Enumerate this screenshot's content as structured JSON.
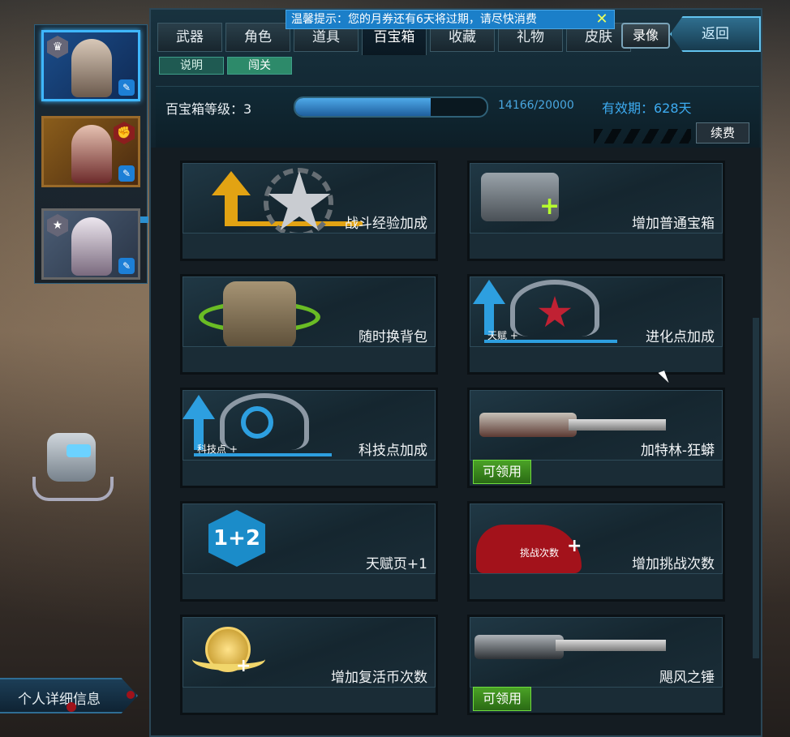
{
  "notice": {
    "text": "温馨提示：您的月券还有6天将过期，请尽快消费",
    "close_icon": "close-icon",
    "color": "#1b7fc9"
  },
  "tabs": [
    {
      "label": "武器"
    },
    {
      "label": "角色"
    },
    {
      "label": "道具"
    },
    {
      "label": "百宝箱",
      "active": true
    },
    {
      "label": "收藏"
    },
    {
      "label": "礼物"
    },
    {
      "label": "皮肤"
    }
  ],
  "record_button": "录像",
  "back_button": "返回",
  "subtabs": [
    {
      "label": "说明"
    },
    {
      "label": "闯关",
      "active": true
    }
  ],
  "treasure": {
    "level_label": "百宝箱等级：3",
    "progress_current": 14166,
    "progress_max": 20000,
    "progress_text": "14166/20000",
    "valid_text": "有效期：628天",
    "renew_button": "续费"
  },
  "items": [
    {
      "label": "战斗经验加成",
      "icon": "battle-exp-star-icon"
    },
    {
      "label": "增加普通宝箱",
      "icon": "crate-plus-icon"
    },
    {
      "label": "随时换背包",
      "icon": "backpack-icon"
    },
    {
      "label": "进化点加成",
      "icon": "evolution-wings-icon",
      "icon_text": "天赋 +"
    },
    {
      "label": "科技点加成",
      "icon": "tech-wings-icon",
      "icon_text": "科技点 +"
    },
    {
      "label": "加特林-狂蟒",
      "icon": "gatling-gun-icon",
      "claim": "可领用"
    },
    {
      "label": "天赋页+1",
      "icon": "talent-page-hex-icon",
      "icon_text": "1+2"
    },
    {
      "label": "增加挑战次数",
      "icon": "challenge-splat-icon",
      "icon_text": "挑战次数"
    },
    {
      "label": "增加复活币次数",
      "icon": "revive-coin-icon"
    },
    {
      "label": "飓风之锤",
      "icon": "minigun-icon",
      "claim": "可领用"
    }
  ],
  "sidebar": {
    "characters": [
      {
        "name": "masked-soldier",
        "active": true
      },
      {
        "name": "red-haired-woman"
      },
      {
        "name": "white-haired-woman"
      }
    ],
    "profile_button": "个人详细信息"
  },
  "colors": {
    "accent": "#3dabf0",
    "claim": "#4aa226",
    "panel": "#141c22"
  }
}
